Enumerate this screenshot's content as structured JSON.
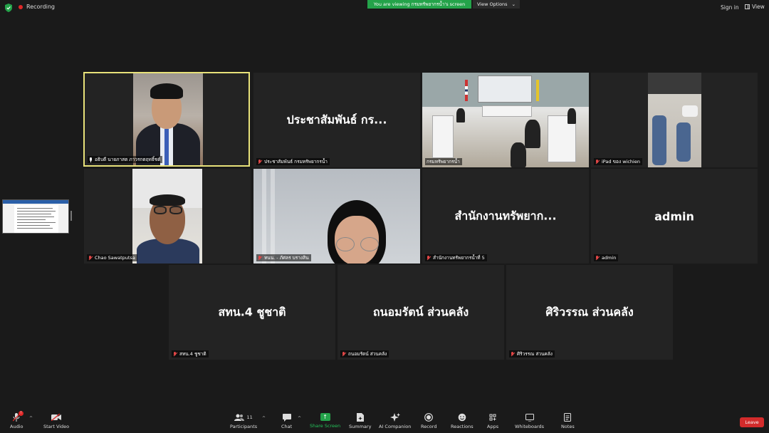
{
  "topbar": {
    "recording_label": "Recording",
    "banner_text": "You are viewing กรมทรัพยากรน้ำ's screen",
    "view_options_label": "View Options",
    "sign_in_label": "Sign in",
    "view_label": "View"
  },
  "participants": [
    {
      "name": "อธิบดี นายภาสต ภาวรกตฤทธิ์ชต์",
      "display": "",
      "muted": false,
      "active_speaker": true,
      "video": "speaker"
    },
    {
      "name": "ประชาสัมพันธ์ กรมทรัพยากรน้ำ",
      "display": "ประชาสัมพันธ์ กร...",
      "muted": true,
      "active_speaker": false,
      "video": "none"
    },
    {
      "name": "กรมทรัพยากรน้ำ",
      "display": "",
      "muted": true,
      "active_speaker": false,
      "video": "meeting-room"
    },
    {
      "name": "iPad ของ wichien",
      "display": "",
      "muted": true,
      "active_speaker": false,
      "video": "car"
    },
    {
      "name": "Chao Sawatputsa",
      "display": "",
      "muted": true,
      "active_speaker": false,
      "video": "man-van"
    },
    {
      "name": "ทนน. - ภัศลร บรางสิน",
      "display": "",
      "muted": true,
      "active_speaker": false,
      "video": "woman"
    },
    {
      "name": "สำนักงานทรัพยากรน้ำที่ 5",
      "display": "สำนักงานทรัพยาก...",
      "muted": true,
      "active_speaker": false,
      "video": "none"
    },
    {
      "name": "admin",
      "display": "admin",
      "muted": true,
      "active_speaker": false,
      "video": "none"
    },
    {
      "name": "สทน.4 ชูชาติ",
      "display": "สทน.4 ชูชาติ",
      "muted": true,
      "active_speaker": false,
      "video": "none"
    },
    {
      "name": "ถนอมรัตน์ ส่วนคลัง",
      "display": "ถนอมรัตน์  ส่วนคลัง",
      "muted": true,
      "active_speaker": false,
      "video": "none"
    },
    {
      "name": "ศิริวรรณ ส่วนคลัง",
      "display": "ศิริวรรณ  ส่วนคลัง",
      "muted": true,
      "active_speaker": false,
      "video": "none"
    }
  ],
  "toolbar": {
    "audio": "Audio",
    "start_video": "Start Video",
    "participants": "Participants",
    "participants_count": "11",
    "chat": "Chat",
    "share_screen": "Share Screen",
    "summary": "Summary",
    "ai_companion": "AI Companion",
    "record": "Record",
    "reactions": "Reactions",
    "apps": "Apps",
    "whiteboards": "Whiteboards",
    "notes": "Notes",
    "leave": "Leave"
  },
  "colors": {
    "active_speaker_border": "#e8e27a",
    "share_green": "#24a34a",
    "leave_red": "#d32b2b",
    "muted_red": "#e04646"
  }
}
